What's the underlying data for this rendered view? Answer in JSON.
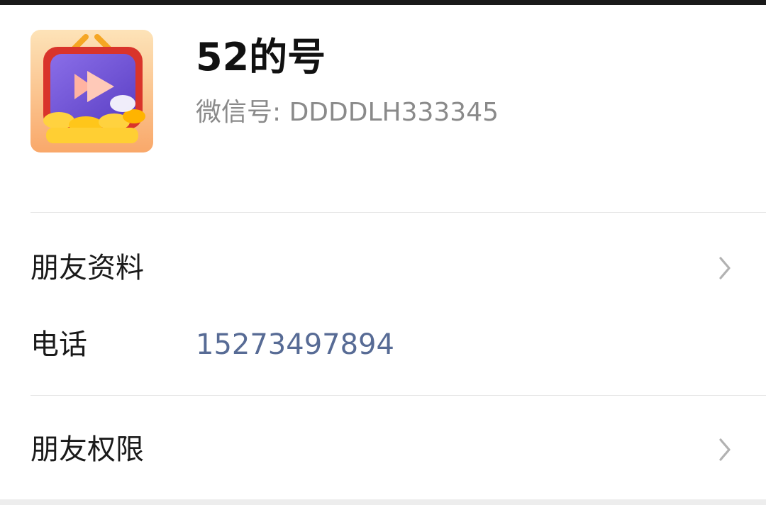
{
  "profile": {
    "name": "52的号",
    "wechat_id": "微信号: DDDDLH333345"
  },
  "rows": {
    "friend_profile": {
      "label": "朋友资料",
      "icon": "chevron-right-icon"
    },
    "phone": {
      "label": "电话",
      "value": "15273497894"
    },
    "friend_permissions": {
      "label": "朋友权限",
      "icon": "chevron-right-icon"
    }
  },
  "colors": {
    "phone_link": "#576b95",
    "secondary_text": "#8a8a8a",
    "divider": "#e6e6e6"
  }
}
